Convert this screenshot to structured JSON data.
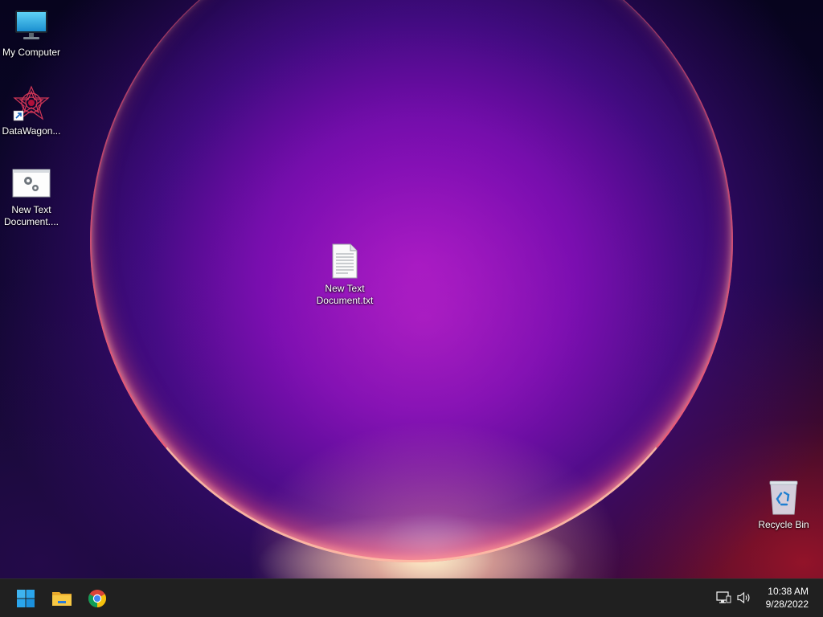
{
  "desktop": {
    "icons": [
      {
        "label": "My Computer",
        "icon": "monitor-icon"
      },
      {
        "label": "DataWagon...",
        "icon": "datawagon-shortcut-icon"
      },
      {
        "label": "New Text Document....",
        "icon": "settings-document-icon"
      },
      {
        "label": "New Text Document.txt",
        "icon": "text-file-icon"
      },
      {
        "label": "Recycle Bin",
        "icon": "recycle-bin-icon"
      }
    ]
  },
  "taskbar": {
    "apps": [
      {
        "name": "Start",
        "icon": "windows-start-icon"
      },
      {
        "name": "File Explorer",
        "icon": "folder-icon"
      },
      {
        "name": "Google Chrome",
        "icon": "chrome-icon"
      }
    ],
    "tray": {
      "network_icon": "network-icon",
      "volume_icon": "volume-icon"
    },
    "clock": {
      "time": "10:38 AM",
      "date": "9/28/2022"
    }
  },
  "colors": {
    "taskbar_bg": "#202020",
    "windows_blue": "#0a84d6",
    "folder_yellow": "#f2b93b"
  }
}
